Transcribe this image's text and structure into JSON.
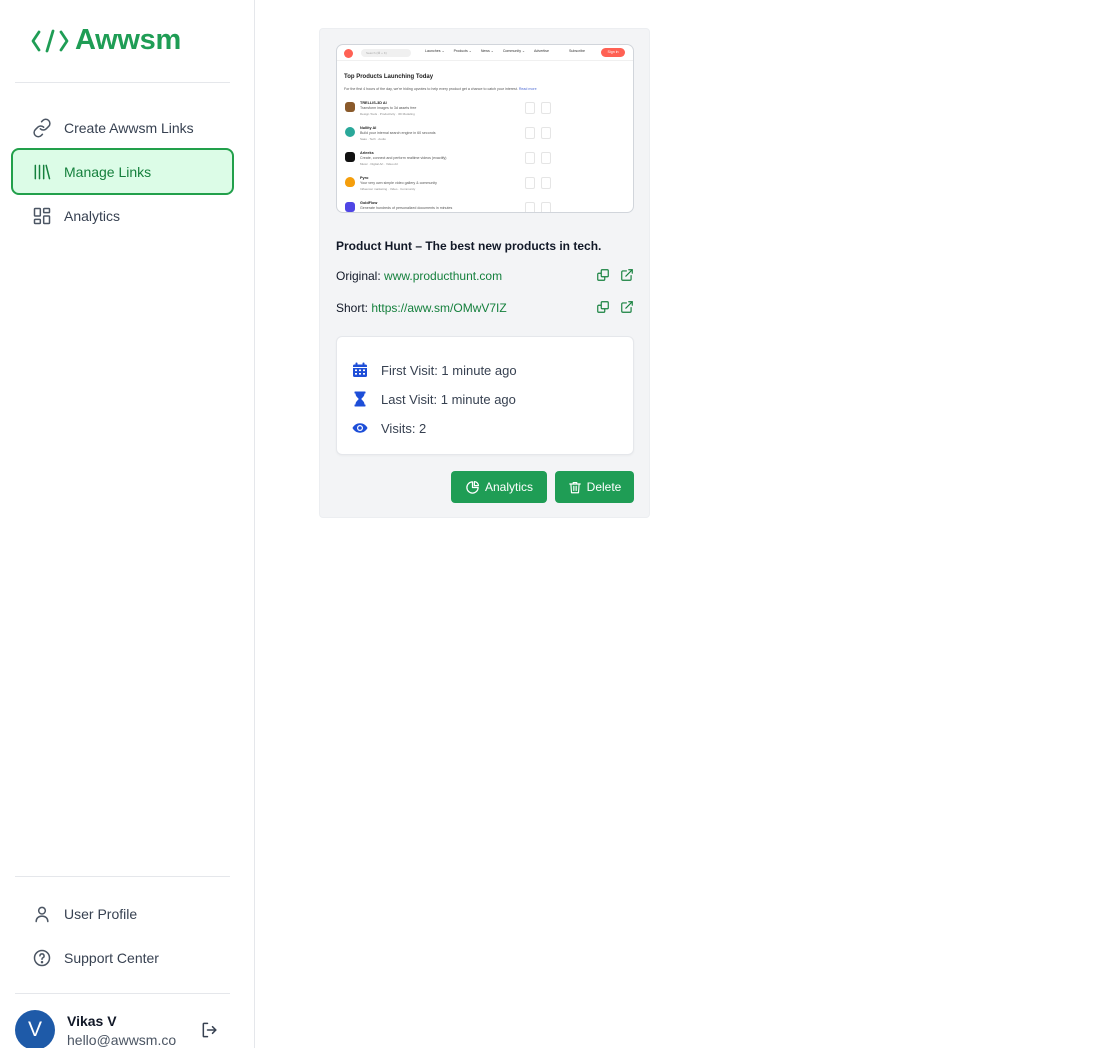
{
  "brand": {
    "name": "Awwsm",
    "color": "#1f9d55"
  },
  "sidebar": {
    "nav": [
      {
        "label": "Create Awwsm Links",
        "icon": "link-icon"
      },
      {
        "label": "Manage Links",
        "icon": "library-icon",
        "active": true
      },
      {
        "label": "Analytics",
        "icon": "dashboard-icon"
      }
    ],
    "bottom": [
      {
        "label": "User Profile",
        "icon": "user-icon"
      },
      {
        "label": "Support Center",
        "icon": "help-circle-icon"
      }
    ],
    "user": {
      "initial": "V",
      "name": "Vikas V",
      "email": "hello@awwsm.co"
    }
  },
  "card": {
    "title": "Product Hunt – The best new products in tech.",
    "original_label": "Original:",
    "original_url": "www.producthunt.com",
    "short_label": "Short:",
    "short_url": "https://aww.sm/OMwV7IZ",
    "stats": {
      "first_visit": "First Visit: 1 minute ago",
      "last_visit": "Last Visit: 1 minute ago",
      "visits": "Visits: 2"
    },
    "buttons": {
      "analytics": "Analytics",
      "delete": "Delete"
    },
    "preview": {
      "search_placeholder": "Search (⌘ + K)",
      "nav": [
        "Launches ⌄",
        "Products ⌄",
        "News ⌄",
        "Community ⌄",
        "Advertise"
      ],
      "subscribe": "Subscribe",
      "signin": "Sign in",
      "heading": "Top Products Launching Today",
      "intro": "For the first 4 hours of the day, we're hiding upvotes to help every product get a chance to catch your interest.",
      "intro_link": "Read more",
      "items": [
        {
          "name": "TRELLIS-3D AI",
          "desc": "Transform images to 3d assets free",
          "tags": "Design Tools · Productivity · 3D Modeling",
          "color": "#8a5a2b"
        },
        {
          "name": "Nullity AI",
          "desc": "Build your internal search engine in 60 seconds",
          "tags": "Saas · Tech · Audio",
          "color": "#2aa89a"
        },
        {
          "name": "Arleeks",
          "desc": "Create, connect and perform realtime videos (exactify)",
          "tags": "Music · Digital Art · Video Art",
          "color": "#111111"
        },
        {
          "name": "Pyro",
          "desc": "Your very own simple video gallery & community",
          "tags": "Influencer marketing · Video · Community",
          "color": "#f59e0b"
        },
        {
          "name": "GoldFlow",
          "desc": "Generate hundreds of personalized documents in minutes",
          "tags": "",
          "color": "#4f46e5"
        }
      ]
    }
  }
}
